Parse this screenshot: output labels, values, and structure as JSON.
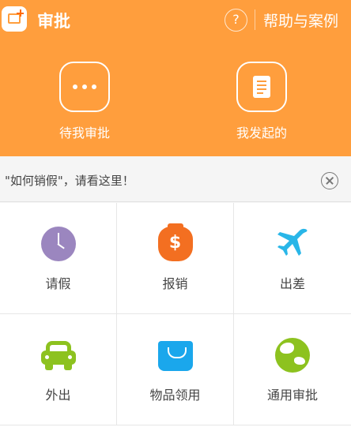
{
  "header": {
    "title": "审批",
    "help_icon_glyph": "?",
    "help_link": "帮助与案例",
    "background_color": "#ff9e3d"
  },
  "quick_actions": [
    {
      "label": "待我审批",
      "icon": "more-dots-icon"
    },
    {
      "label": "我发起的",
      "icon": "document-icon"
    }
  ],
  "notice": {
    "text": "\"如何销假\"，请看这里！",
    "close_icon": "close-circle-icon"
  },
  "grid": {
    "items": [
      {
        "label": "请假",
        "icon": "clock-icon",
        "color": "#9b86bf"
      },
      {
        "label": "报销",
        "icon": "money-bag-icon",
        "color": "#f36f21",
        "glyph": "$"
      },
      {
        "label": "出差",
        "icon": "airplane-icon",
        "color": "#29b6e8"
      },
      {
        "label": "外出",
        "icon": "car-icon",
        "color": "#8dc21f"
      },
      {
        "label": "物品领用",
        "icon": "shopping-bag-icon",
        "color": "#1aa7ec"
      },
      {
        "label": "通用审批",
        "icon": "globe-icon",
        "color": "#8dc21f"
      }
    ]
  }
}
